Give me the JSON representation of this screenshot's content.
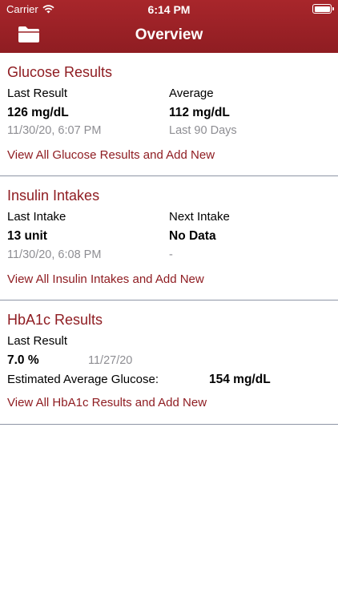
{
  "status_bar": {
    "carrier": "Carrier",
    "time": "6:14 PM"
  },
  "nav": {
    "title": "Overview",
    "folder_icon": "folder-icon"
  },
  "glucose": {
    "title": "Glucose Results",
    "last_label": "Last Result",
    "last_value": "126 mg/dL",
    "last_date": "11/30/20, 6:07 PM",
    "avg_label": "Average",
    "avg_value": "112 mg/dL",
    "avg_period": "Last 90 Days",
    "link": "View All Glucose Results and Add New"
  },
  "insulin": {
    "title": "Insulin Intakes",
    "last_label": "Last Intake",
    "last_value": "13 unit",
    "last_date": "11/30/20, 6:08 PM",
    "next_label": "Next Intake",
    "next_value": "No Data",
    "next_date": "-",
    "link": "View All Insulin Intakes and Add New"
  },
  "hba1c": {
    "title": "HbA1c Results",
    "last_label": "Last Result",
    "last_value": "7.0 %",
    "last_date": "11/27/20",
    "eag_label": "Estimated Average Glucose:",
    "eag_value": "154 mg/dL",
    "link": "View All HbA1c Results and Add New"
  },
  "colors": {
    "brand": "#8f1d22",
    "muted": "#8e8e93",
    "divider": "#8e95a6"
  }
}
